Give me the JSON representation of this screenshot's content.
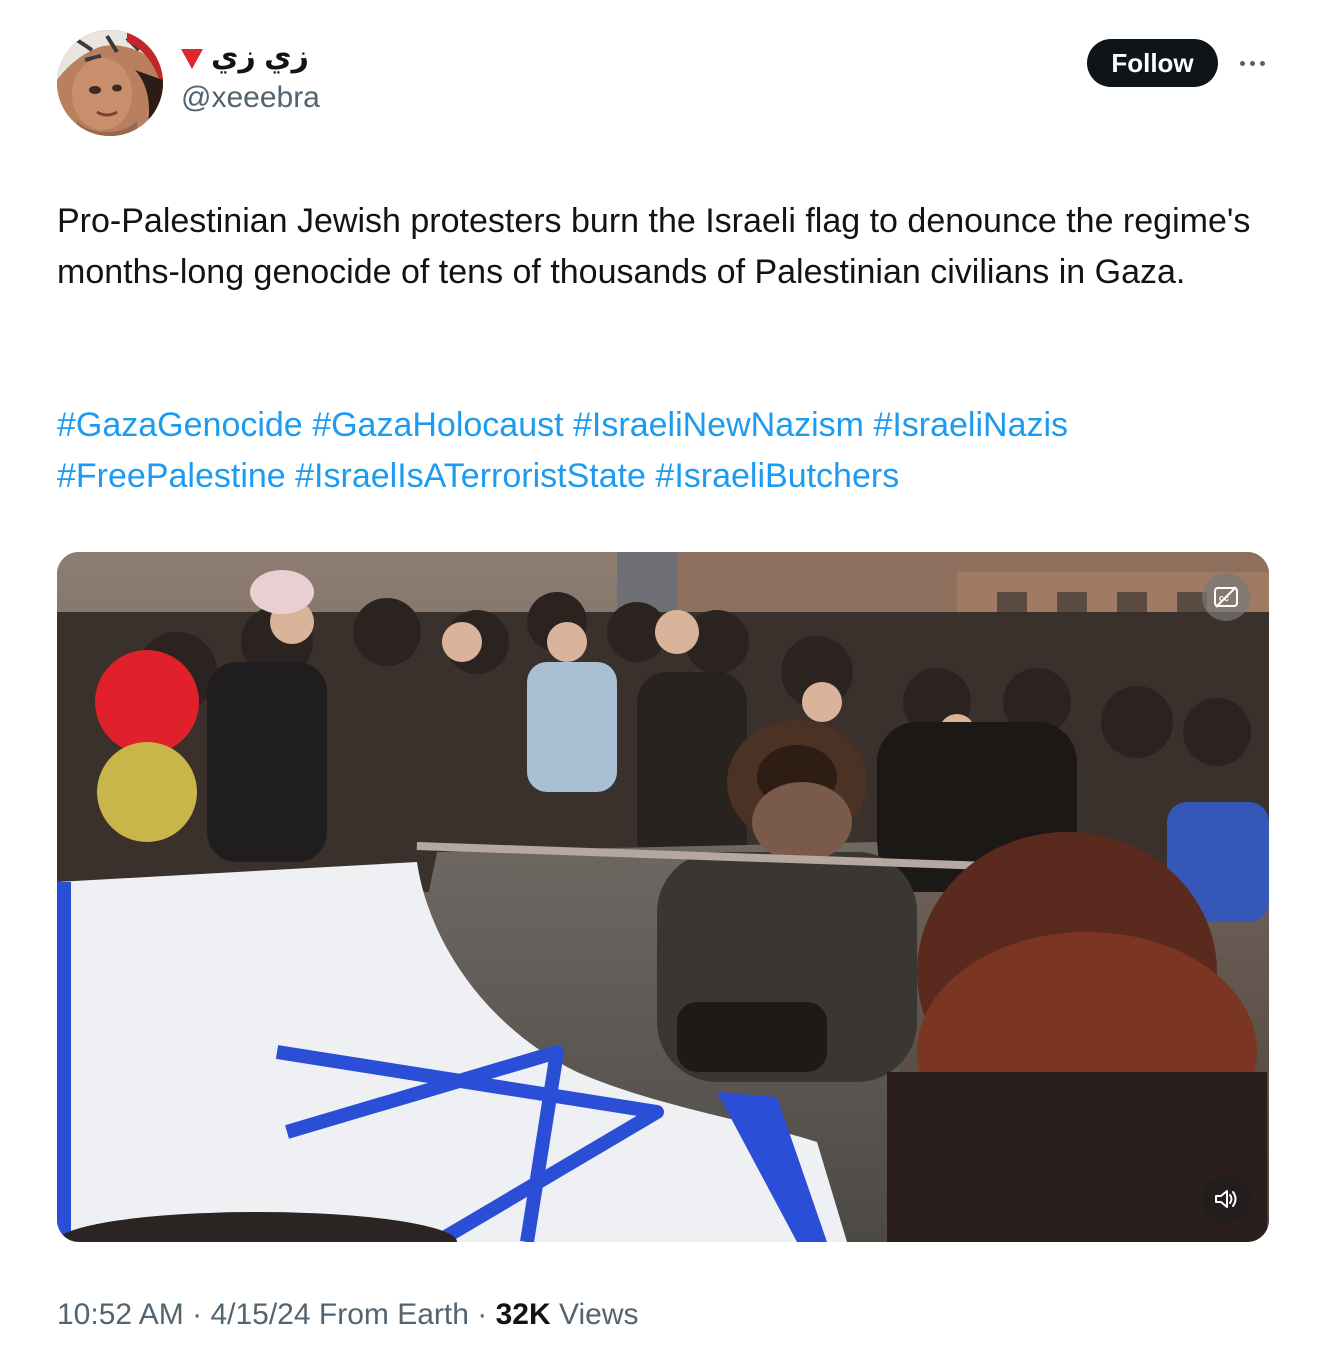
{
  "author": {
    "display_name": "زي زي",
    "handle": "@xeeebra",
    "badge_icon": "red-triangle-icon"
  },
  "header": {
    "follow_label": "Follow",
    "more_icon": "more-options-icon"
  },
  "tweet": {
    "text": "Pro-Palestinian Jewish protesters burn the Israeli flag to denounce the regime's months-long genocide of tens of thousands of Palestinian civilians in Gaza.",
    "hashtags": [
      "#GazaGenocide",
      "#GazaHolocaust",
      "#IsraeliNewNazism",
      "#IsraeliNazis",
      "#FreePalestine",
      "#IsraelIsATerroristState",
      "#IsraeliButchers"
    ]
  },
  "media": {
    "type": "video",
    "captions_icon": "captions-off-icon",
    "volume_icon": "speaker-icon"
  },
  "meta": {
    "time": "10:52 AM",
    "separator": "·",
    "date": "4/15/24",
    "source": "From Earth",
    "views_count": "32K",
    "views_label": "Views"
  },
  "colors": {
    "link": "#1d9bf0",
    "text": "#0f1419",
    "secondary": "#536471",
    "follow_bg": "#0f1419",
    "badge": "#e0262c",
    "flag_blue": "#2a4fd6"
  }
}
